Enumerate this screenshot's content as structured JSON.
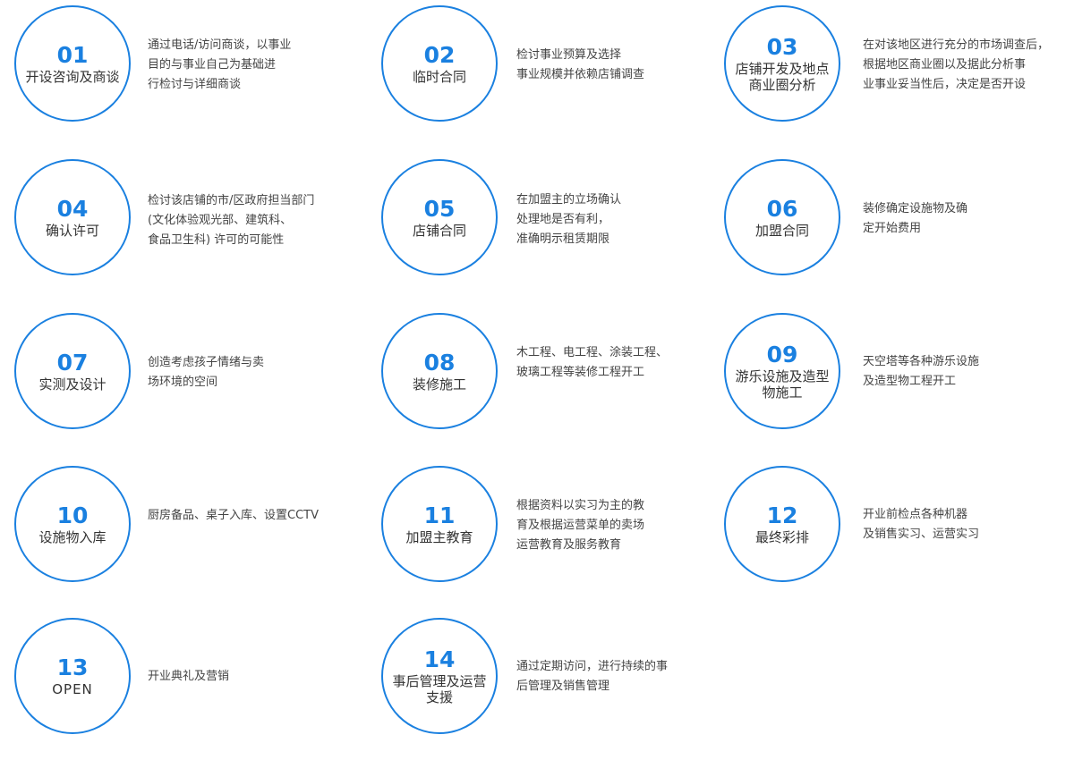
{
  "accent_color": "#1a80e0",
  "steps": [
    {
      "num": "01",
      "title": "开设咨询及商谈",
      "desc": "通过电话/访问商谈，以事业\n目的与事业自己为基础进\n行检讨与详细商谈"
    },
    {
      "num": "02",
      "title": "临时合同",
      "desc": "检讨事业预算及选择\n事业规模并依赖店铺调查"
    },
    {
      "num": "03",
      "title": "店铺开发及地点商业圈分析",
      "desc": "在对该地区进行充分的市场调查后，\n根据地区商业圈以及据此分析事\n业事业妥当性后，决定是否开设"
    },
    {
      "num": "04",
      "title": "确认许可",
      "desc": "检讨该店铺的市/区政府担当部门\n(文化体验观光部、建筑科、\n食品卫生科) 许可的可能性"
    },
    {
      "num": "05",
      "title": "店铺合同",
      "desc": "在加盟主的立场确认\n处理地是否有利，\n准确明示租赁期限"
    },
    {
      "num": "06",
      "title": "加盟合同",
      "desc": "装修确定设施物及确\n定开始费用"
    },
    {
      "num": "07",
      "title": "实测及设计",
      "desc": "创造考虑孩子情绪与卖\n场环境的空间"
    },
    {
      "num": "08",
      "title": "装修施工",
      "desc": "木工程、电工程、涂装工程、\n玻璃工程等装修工程开工"
    },
    {
      "num": "09",
      "title": "游乐设施及造型物施工",
      "desc": "天空塔等各种游乐设施\n及造型物工程开工"
    },
    {
      "num": "10",
      "title": "设施物入库",
      "desc": "厨房备品、桌子入库、设置CCTV"
    },
    {
      "num": "11",
      "title": "加盟主教育",
      "desc": "根据资料以实习为主的教\n育及根据运营菜单的卖场\n运营教育及服务教育"
    },
    {
      "num": "12",
      "title": "最终彩排",
      "desc": "开业前检点各种机器\n及销售实习、运营实习"
    },
    {
      "num": "13",
      "title": "OPEN",
      "desc": "开业典礼及营销"
    },
    {
      "num": "14",
      "title": "事后管理及运营支援",
      "desc": "通过定期访问，进行持续的事\n后管理及销售管理"
    }
  ]
}
